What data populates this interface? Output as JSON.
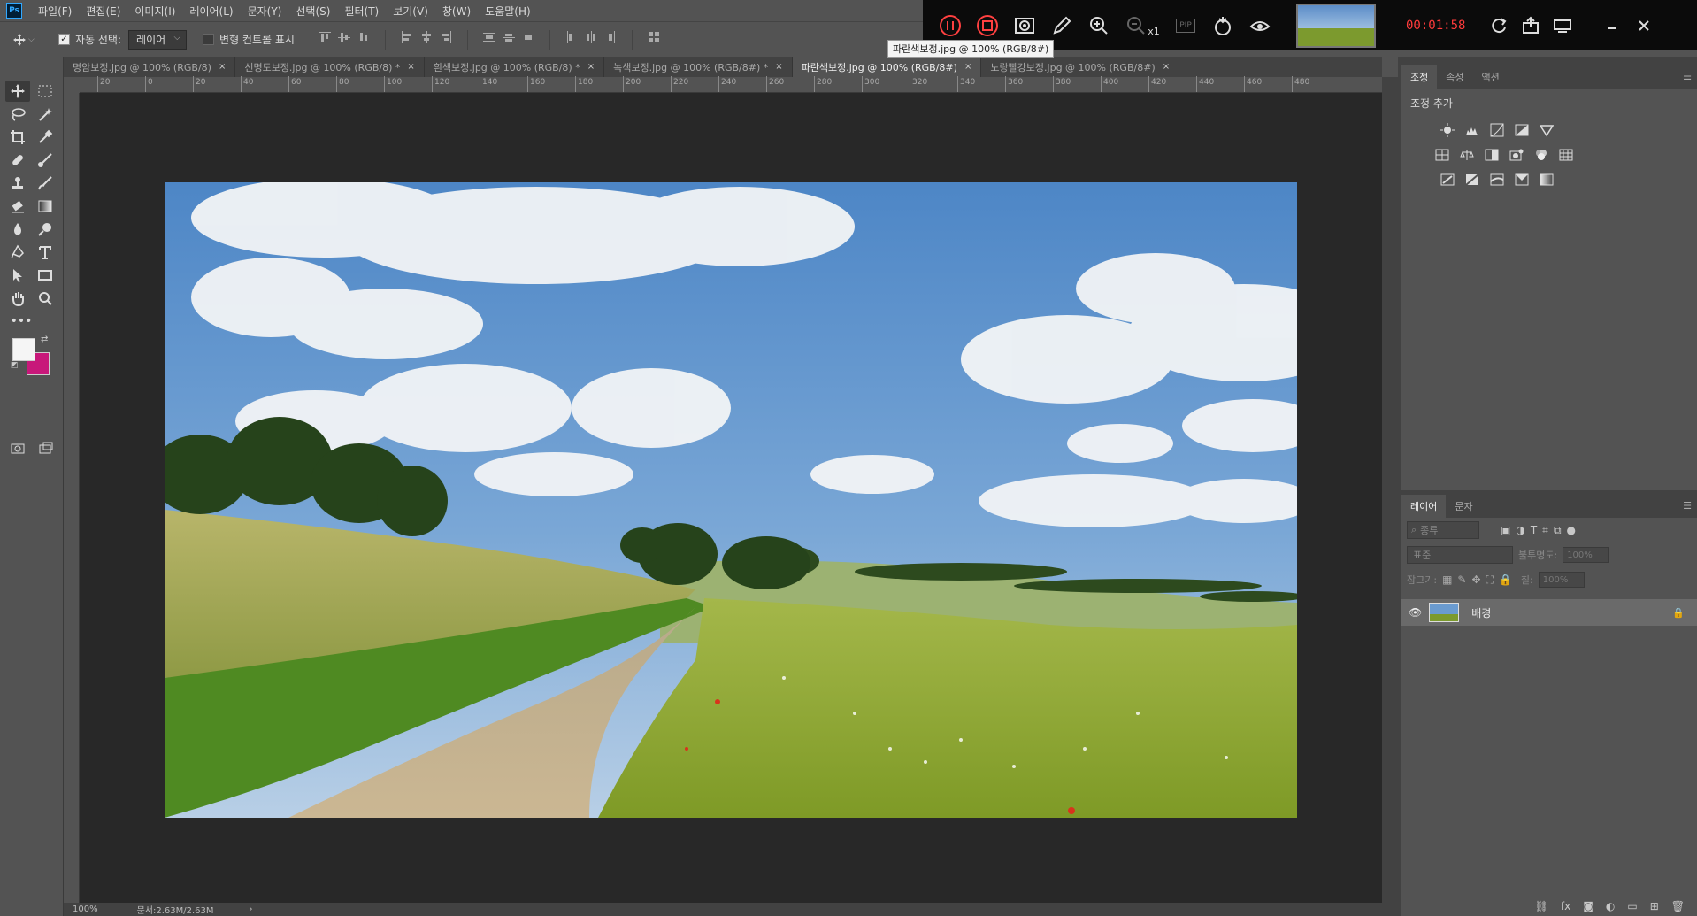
{
  "app": {
    "logo": "Ps"
  },
  "menu": [
    "파일(F)",
    "편집(E)",
    "이미지(I)",
    "레이어(L)",
    "문자(Y)",
    "선택(S)",
    "필터(T)",
    "보기(V)",
    "창(W)",
    "도움말(H)"
  ],
  "options": {
    "auto_select_label": "자동 선택:",
    "auto_select_value": "레이어",
    "transform_label": "변형 컨트롤 표시"
  },
  "recorder": {
    "timer": "00:01:58",
    "zoom_factor": "x1",
    "pip_label": "PIP",
    "tooltip": "파란색보정.jpg @ 100% (RGB/8#)"
  },
  "tabs": [
    {
      "label": "명암보정.jpg @ 100% (RGB/8)",
      "active": false
    },
    {
      "label": "선명도보정.jpg @ 100% (RGB/8) *",
      "active": false
    },
    {
      "label": "흰색보정.jpg @ 100% (RGB/8) *",
      "active": false
    },
    {
      "label": "녹색보정.jpg @ 100% (RGB/8#) *",
      "active": false
    },
    {
      "label": "파란색보정.jpg @ 100% (RGB/8#)",
      "active": true
    },
    {
      "label": "노랑빨강보정.jpg @ 100% (RGB/8#)",
      "active": false
    }
  ],
  "tab_close": "×",
  "ruler": {
    "top": [
      "20",
      "0",
      "20",
      "40",
      "60",
      "80",
      "100",
      "120",
      "140",
      "160",
      "180",
      "200",
      "220",
      "240",
      "260",
      "280",
      "300",
      "320",
      "340",
      "360",
      "380",
      "400",
      "420",
      "440",
      "460",
      "480"
    ]
  },
  "status": {
    "zoom": "100%",
    "doc": "문서:2.63M/2.63M"
  },
  "colors": {
    "foreground": "#f5f5f5",
    "background": "#c8187a",
    "recorder_timer": "#ff3b3b"
  },
  "adjustments_panel": {
    "tabs": [
      "조정",
      "속성",
      "액션"
    ],
    "title": "조정 추가"
  },
  "layers_panel": {
    "tabs": [
      "레이어",
      "문자"
    ],
    "search_placeholder": "종류",
    "blend_mode": "표준",
    "opacity_label": "불투명도:",
    "opacity_value": "100%",
    "lock_label": "잠그기:",
    "fill_label": "칠:",
    "fill_value": "100%",
    "layers": [
      {
        "name": "배경",
        "locked": true,
        "visible": true
      }
    ]
  }
}
